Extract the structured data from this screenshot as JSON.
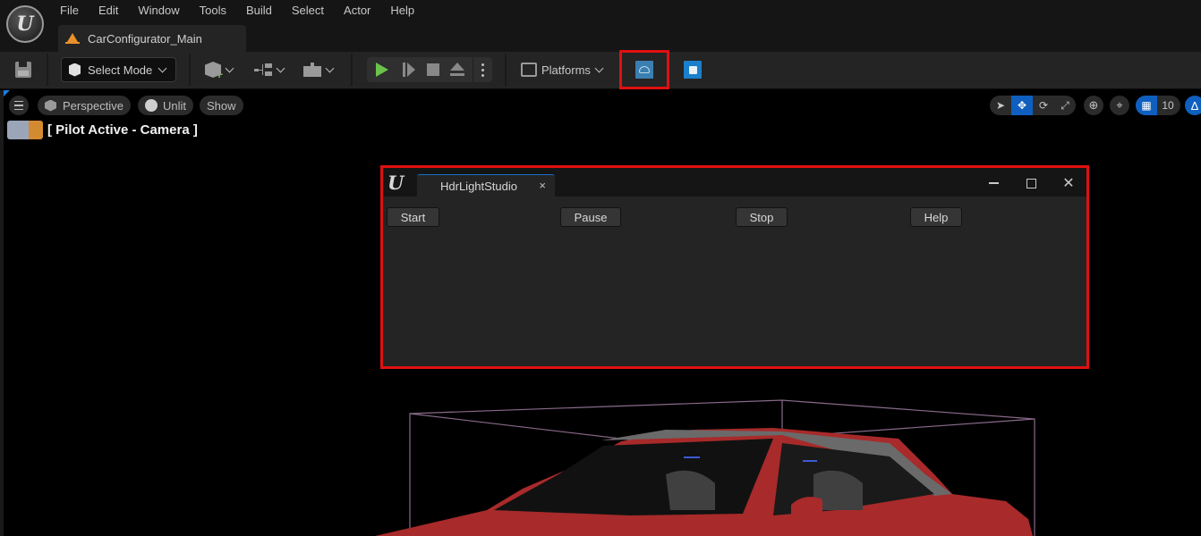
{
  "menubar": {
    "items": [
      "File",
      "Edit",
      "Window",
      "Tools",
      "Build",
      "Select",
      "Actor",
      "Help"
    ]
  },
  "document_tab": {
    "label": "CarConfigurator_Main",
    "icon": "level-icon"
  },
  "toolbar": {
    "save_icon": "save-icon",
    "select_mode_label": "Select Mode",
    "add_icon": "add-actor-icon",
    "blueprint_icon": "blueprint-icon",
    "cinematics_icon": "clapperboard-icon",
    "play_icons": [
      "play-icon",
      "step-icon",
      "stop-icon",
      "eject-icon",
      "more-options-icon"
    ],
    "platforms_label": "Platforms",
    "plugin_icons": [
      "hdr-light-studio-icon",
      "bridge-icon"
    ],
    "highlight_color": "#e01010"
  },
  "viewport": {
    "perspective_label": "Perspective",
    "unlit_label": "Unlit",
    "show_label": "Show",
    "pilot_label": "[ Pilot Active - Camera ]",
    "grid_snap_value": "10",
    "right_tools": [
      "select-icon",
      "translate-icon",
      "rotate-icon",
      "scale-icon",
      "world-local-icon",
      "surface-snap-icon",
      "grid-snap-icon",
      "angle-snap-icon"
    ],
    "accent": "#0f5fbf"
  },
  "plugin_window": {
    "tab_label": "HdrLightStudio",
    "close_tab": "×",
    "buttons": [
      "Start",
      "Pause",
      "Stop",
      "Help"
    ],
    "highlight_color": "#e01010"
  },
  "scene": {
    "car_color": "#a82a2a",
    "roof_color": "#6a6a6a",
    "bounds_color": "#8a6a8a"
  }
}
